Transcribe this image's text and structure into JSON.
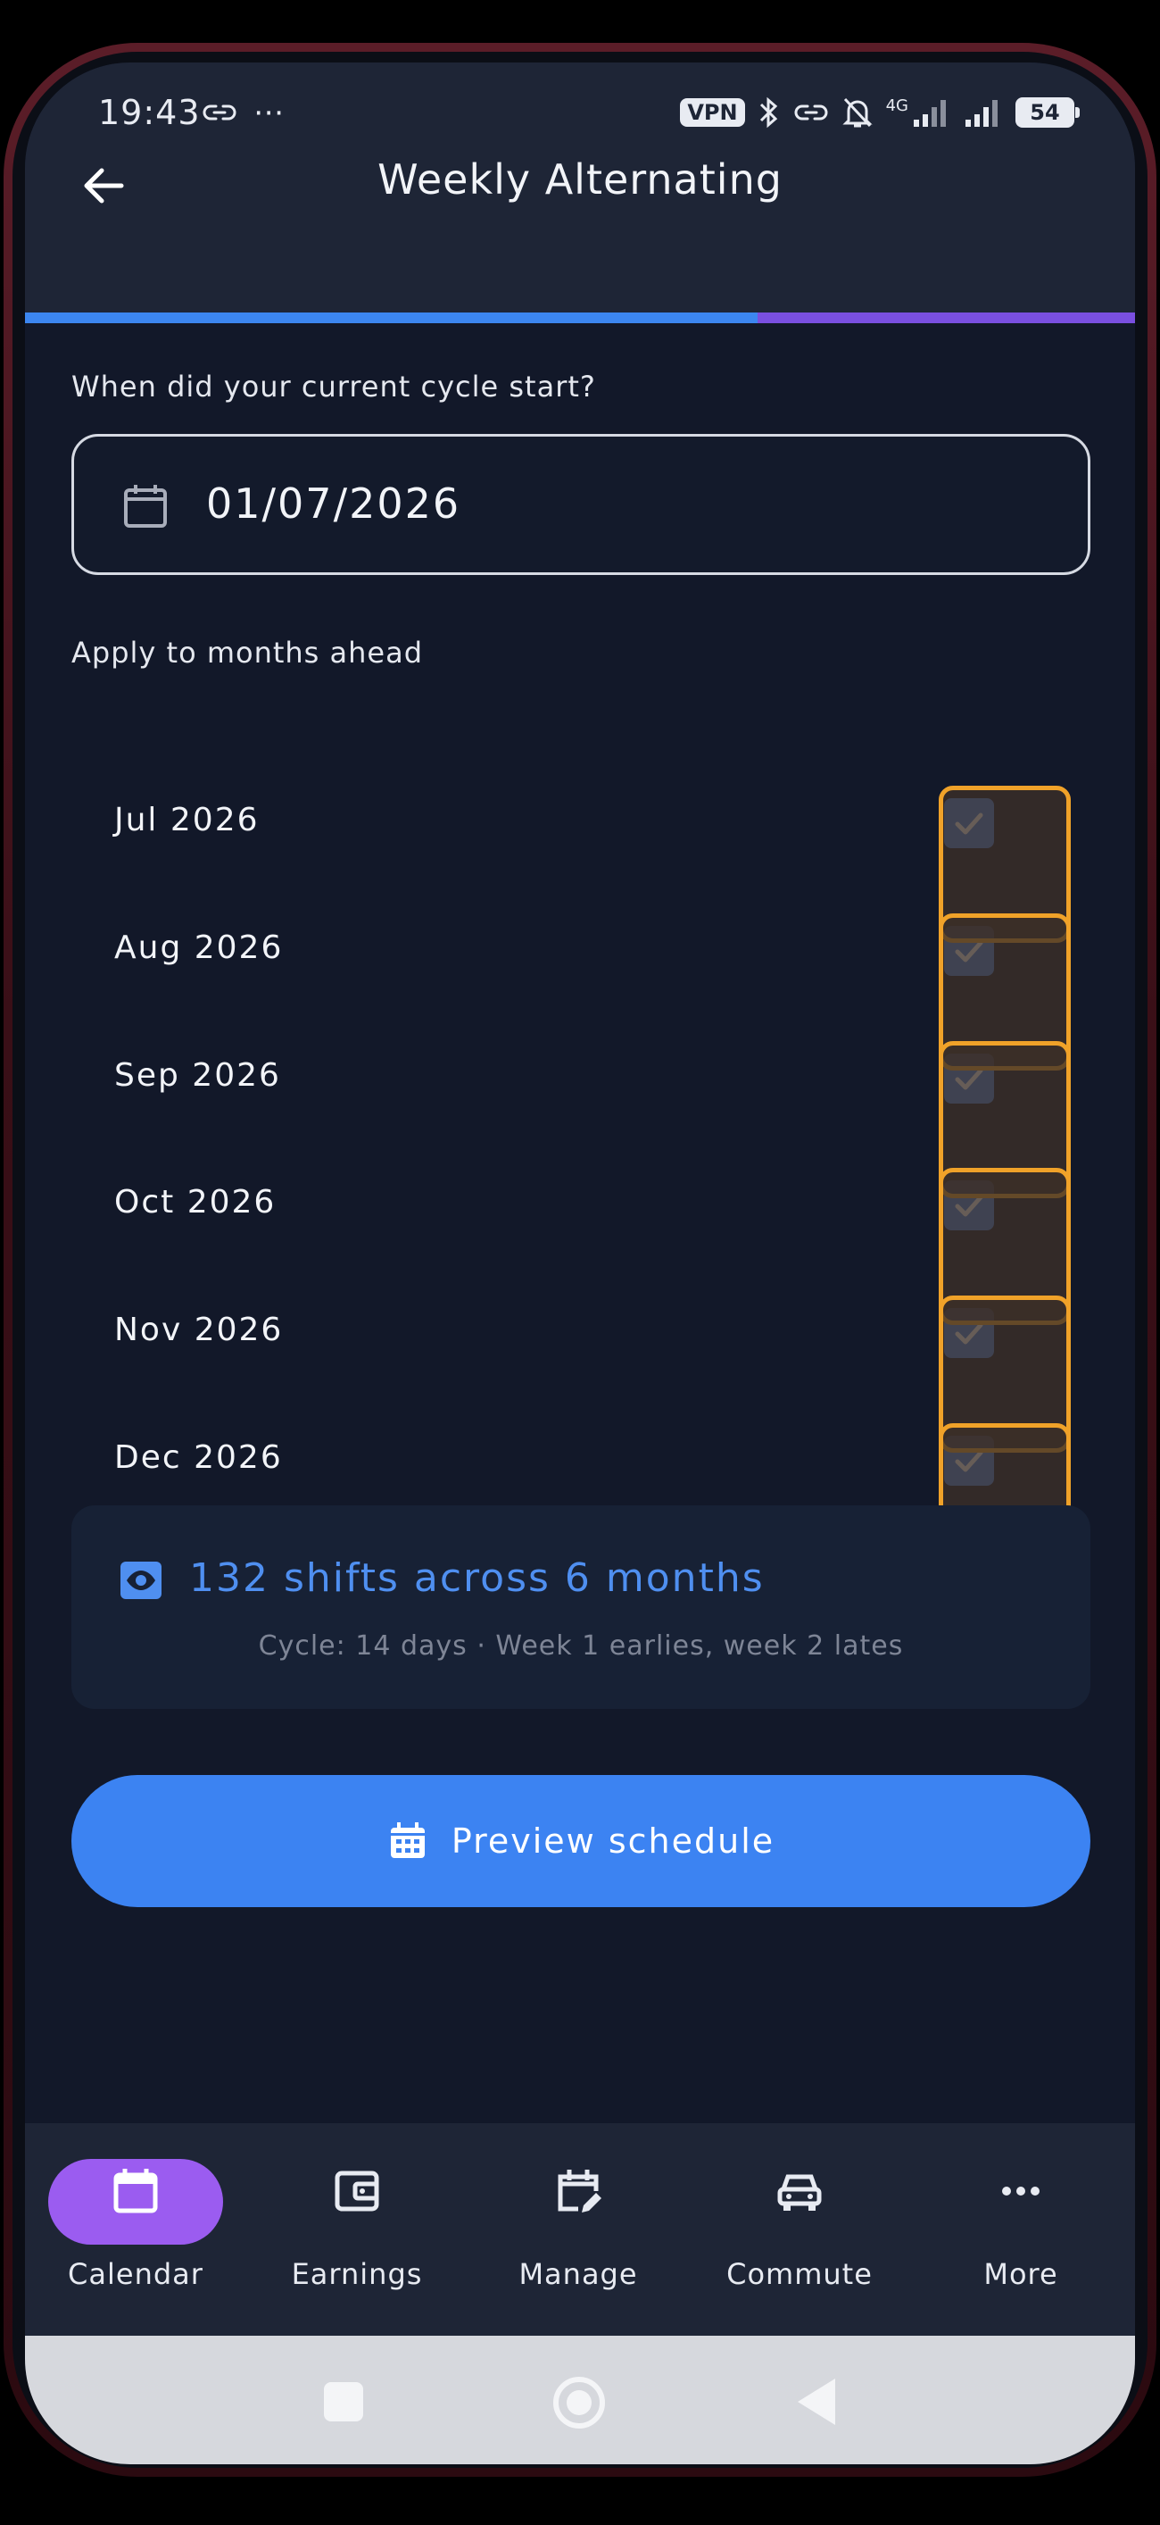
{
  "status_bar": {
    "time": "19:43",
    "extra": "⋯",
    "vpn": "VPN",
    "network": "4G",
    "battery": "54"
  },
  "header": {
    "title": "Weekly Alternating",
    "progress_fraction": 0.66
  },
  "cycle": {
    "question": "When did your current cycle start?",
    "date_value": "01/07/2026"
  },
  "months_section": {
    "label": "Apply to months ahead",
    "months": [
      {
        "label": "Jul 2026",
        "checked": true
      },
      {
        "label": "Aug 2026",
        "checked": true
      },
      {
        "label": "Sep 2026",
        "checked": true
      },
      {
        "label": "Oct 2026",
        "checked": true
      },
      {
        "label": "Nov 2026",
        "checked": true
      },
      {
        "label": "Dec 2026",
        "checked": true
      }
    ]
  },
  "summary": {
    "headline": "132 shifts across 6 months",
    "detail": "Cycle: 14 days · Week 1 earlies, week 2 lates"
  },
  "actions": {
    "preview_label": "Preview schedule"
  },
  "bottom_nav": [
    {
      "label": "Calendar",
      "icon": "calendar-icon",
      "active": true
    },
    {
      "label": "Earnings",
      "icon": "wallet-icon",
      "active": false
    },
    {
      "label": "Manage",
      "icon": "calendar-edit-icon",
      "active": false
    },
    {
      "label": "Commute",
      "icon": "car-icon",
      "active": false
    },
    {
      "label": "More",
      "icon": "more-dots-icon",
      "active": false
    }
  ],
  "colors": {
    "background": "#121829",
    "bar": "#1e2536",
    "accent_blue": "#3c83f2",
    "accent_purple": "#9b5cf0",
    "highlight_orange": "#f0a229"
  }
}
